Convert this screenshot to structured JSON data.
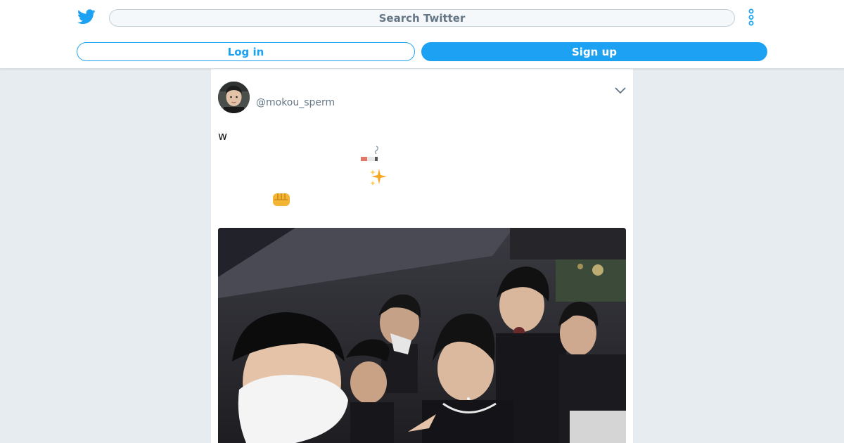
{
  "header": {
    "logo_icon": "twitter-bird-icon",
    "search_placeholder": "Search Twitter",
    "more_icon": "vertical-dots-icon",
    "login_label": "Log in",
    "signup_label": "Sign up",
    "accent_color": "#1da1f2"
  },
  "tweet": {
    "handle": "@mokou_sperm",
    "avatar_icon": "avatar-photo",
    "menu_icon": "chevron-down-icon",
    "text": "w",
    "emojis": [
      "cigarette-icon",
      "sparkles-icon",
      "oncoming-fist-icon"
    ],
    "media_icon": "group-photo"
  }
}
